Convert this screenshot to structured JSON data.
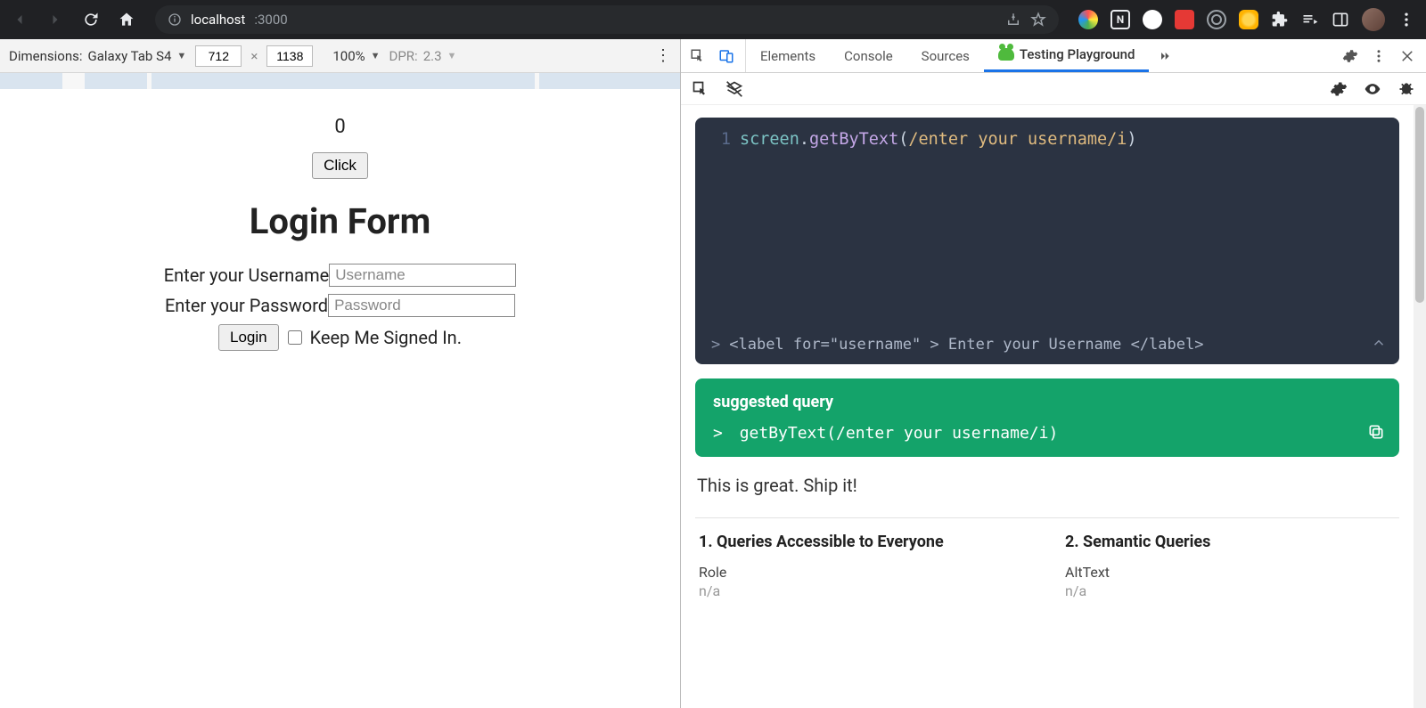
{
  "browser": {
    "url_host": "localhost",
    "url_port": ":3000",
    "info_tooltip": "View site information"
  },
  "deviceBar": {
    "label": "Dimensions:",
    "device": "Galaxy Tab S4",
    "width": "712",
    "height": "1138",
    "zoom": "100%",
    "dprLabel": "DPR:",
    "dprValue": "2.3"
  },
  "app": {
    "counter": "0",
    "clickLabel": "Click",
    "title": "Login Form",
    "usernameLabel": "Enter your Username",
    "usernamePlaceholder": "Username",
    "passwordLabel": "Enter your Password",
    "passwordPlaceholder": "Password",
    "loginLabel": "Login",
    "keepSignedIn": "Keep Me Signed In."
  },
  "devtools": {
    "tabs": [
      "Elements",
      "Console",
      "Sources",
      "Testing Playground"
    ],
    "activeTab": 3
  },
  "playground": {
    "code": {
      "lineNumber": "1",
      "ident": "screen",
      "dot": ".",
      "method": "getByText",
      "open": "(",
      "regex": "/enter your username/i",
      "close": ")"
    },
    "codeResultPrefix": ">",
    "codeResult": "<label for=\"username\" > Enter your Username </label>",
    "suggestedTitle": "suggested query",
    "suggestedPrefix": ">",
    "suggested": "getByText(/enter your username/i)",
    "shipIt": "This is great. Ship it!",
    "queriesA": {
      "heading": "1. Queries Accessible to Everyone",
      "fields": [
        {
          "name": "Role",
          "value": "n/a"
        }
      ]
    },
    "queriesB": {
      "heading": "2. Semantic Queries",
      "fields": [
        {
          "name": "AltText",
          "value": "n/a"
        }
      ]
    }
  }
}
